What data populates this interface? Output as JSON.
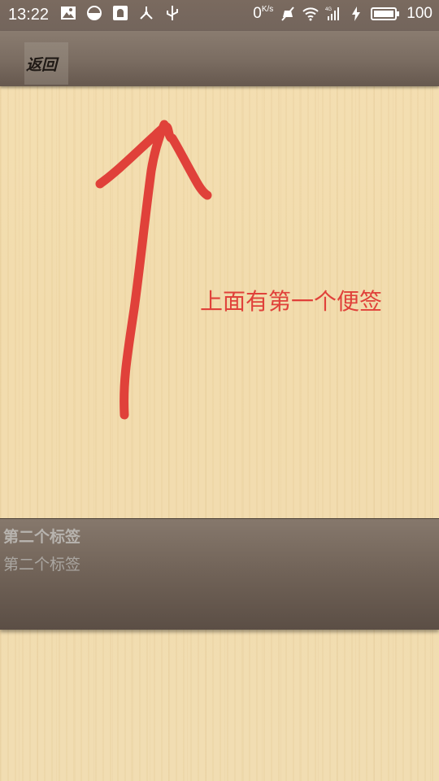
{
  "status_bar": {
    "time": "13:22",
    "net_speed": "0",
    "net_speed_unit": "K/s",
    "battery": "100",
    "icons": [
      "image-icon",
      "contrast-icon",
      "notification-icon",
      "usb-share-icon",
      "usb-icon",
      "mute-icon",
      "wifi-icon",
      "signal-4g-icon",
      "charging-icon",
      "battery-icon"
    ]
  },
  "app_bar": {
    "back_label": "返回"
  },
  "annotation": {
    "text": "上面有第一个便签",
    "color": "#e0413a"
  },
  "note": {
    "title": "第二个标签",
    "body": "第二个标签"
  },
  "colors": {
    "bar": "#7a6c61",
    "wood": "#f2dcad",
    "annotation": "#e0413a"
  }
}
